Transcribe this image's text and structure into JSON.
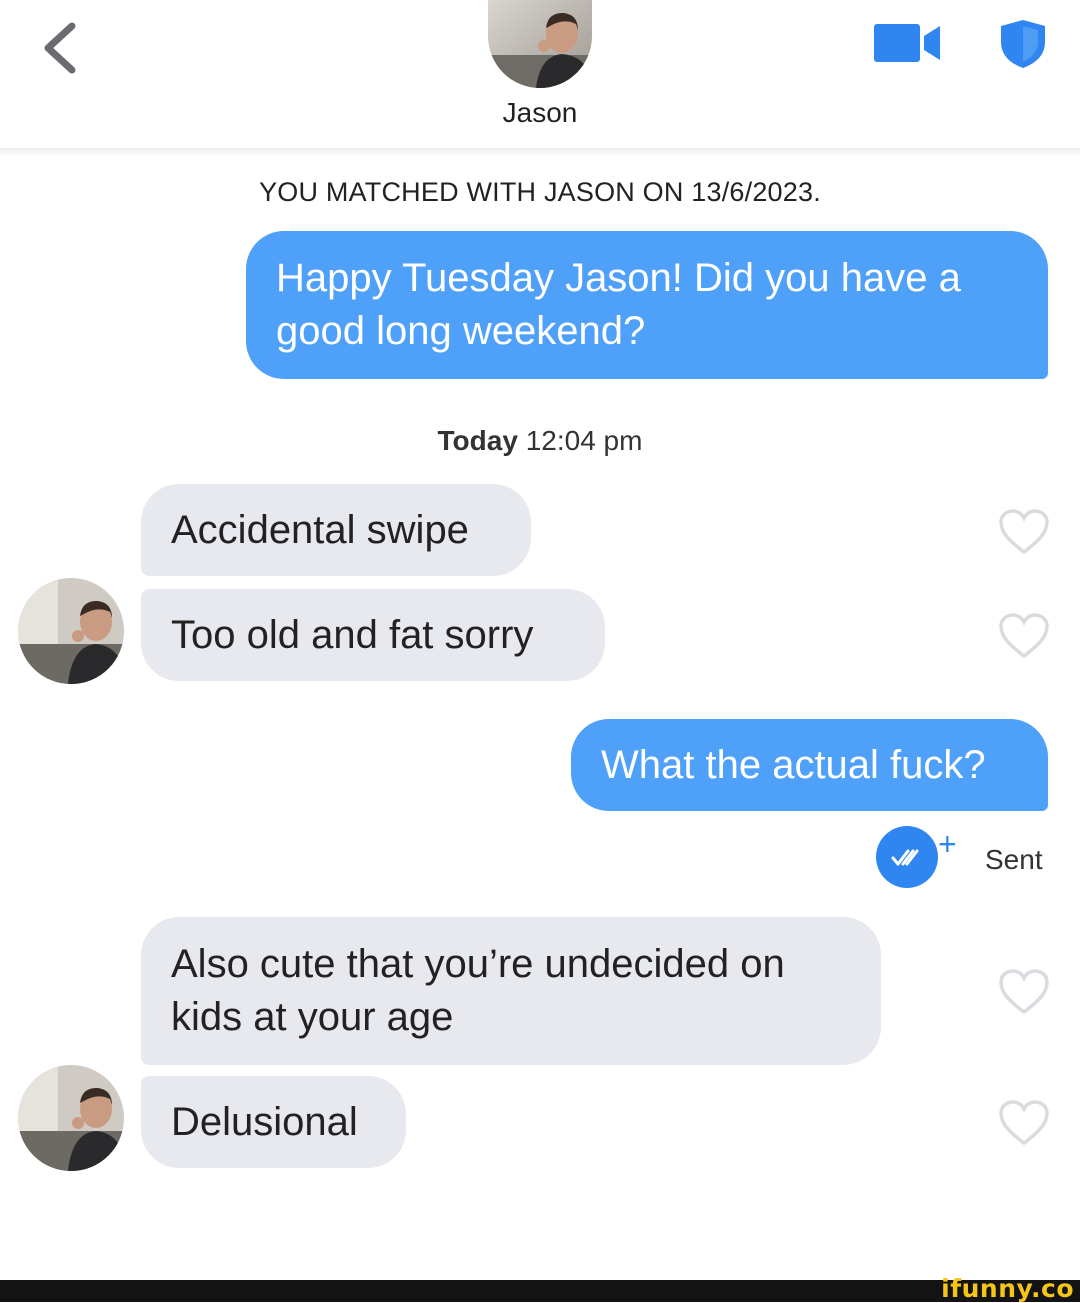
{
  "header": {
    "contact_name": "Jason",
    "icons": {
      "back": "chevron-left-icon",
      "video": "video-camera-icon",
      "safety": "shield-icon"
    }
  },
  "match_notice": "YOU MATCHED WITH JASON ON 13/6/2023.",
  "timestamp": {
    "day": "Today",
    "time": "12:04 pm"
  },
  "messages": [
    {
      "direction": "outgoing",
      "text": "Happy Tuesday Jason! Did you have a good long weekend?"
    },
    {
      "direction": "incoming",
      "text": "Accidental swipe"
    },
    {
      "direction": "incoming",
      "text": "Too old and fat sorry"
    },
    {
      "direction": "outgoing",
      "text": "What the actual fuck?"
    },
    {
      "direction": "incoming",
      "text": "Also cute that you’re undecided on kids at your age"
    },
    {
      "direction": "incoming",
      "text": "Delusional"
    }
  ],
  "read_receipt": {
    "icon": "double-check-icon",
    "plus": "+",
    "label": "Sent"
  },
  "footer": {
    "brand": "ifunny.co"
  },
  "colors": {
    "outgoing": "#4fa0f9",
    "incoming": "#e8e9ee",
    "accent": "#2f86f0",
    "brand": "#f5c518"
  }
}
